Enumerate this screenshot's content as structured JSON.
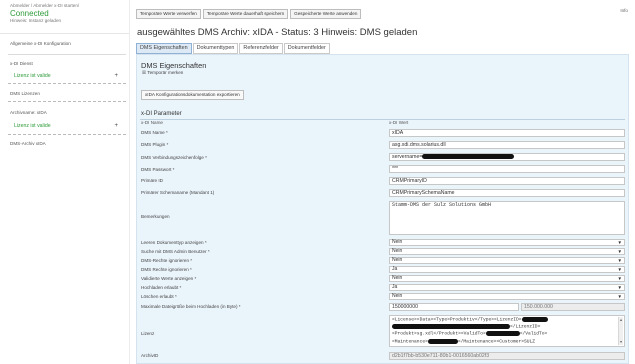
{
  "sidebar": {
    "connection_hint_1": "Abmelder / Abmelder x-DI starten/",
    "status": "Connected",
    "connection_hint_2": "Hinweis: Instanz geladen",
    "allgemein": "Allgemeine x-DI Konfiguration",
    "item1_caption": "x-DI Dienst",
    "item1_value": "Lizenz ist valide",
    "item2_caption": "DMS Lizenzen",
    "item3_caption": "Archivname: xIDA",
    "item3_value": "Lizenz ist valide",
    "item4_caption": "DMS-Archiv xIDA",
    "plus": "+"
  },
  "toolbar": {
    "btn1": "Temporäre Werte verwerfen",
    "btn2": "Temporäre Werte dauerhaft speichern",
    "btn3": "Gespeicherte Werte anwenden",
    "corner": "Info"
  },
  "heading": "ausgewähltes DMS Archiv: xIDA  - Status: 3  Hinweis: DMS geladen",
  "tabs": [
    "DMS Eigenschaften",
    "Dokumenttypen",
    "Referenzfelder",
    "Dokumentfelder"
  ],
  "panel": {
    "title": "DMS Eigenschaften",
    "temp_check": "☒ Temporär merken",
    "export_button": "xIDA Konfigurationsdokumentation exportieren",
    "section": "x-DI Parameter",
    "col_name": "x-DI Name",
    "col_value": "x-DI Wert"
  },
  "fields": [
    {
      "label": "DMS Name *",
      "value": "xIDA"
    },
    {
      "label": "DMS Plugin *",
      "value": "asg.xdi.dms.solarius.dll"
    },
    {
      "label": "DMS Verbindungszeichenfolge *",
      "value": "servername="
    },
    {
      "label": "DMS Passwort *",
      "value": "***"
    },
    {
      "label": "Primäre ID",
      "value": "CRMPrimaryID"
    },
    {
      "label": "Primärer Schemaname (Mandant 1)",
      "value": "CRMPrimarySchemaName"
    }
  ],
  "remarks": {
    "label": "Bemerkungen",
    "value": "Stamm-DMS der Sulz Solutions GmbH"
  },
  "selects": [
    {
      "label": "Leeren Dokumenttyp anzeigen *",
      "value": "Nein"
    },
    {
      "label": "Suche mit DMS Admin Benutzer *",
      "value": "Nein"
    },
    {
      "label": "DMS-Rechte ignorieren *",
      "value": "Nein"
    },
    {
      "label": "DMS Rechte ignorieren *",
      "value": "Ja"
    },
    {
      "label": "Validierte Werte anzeigen *",
      "value": "Nein"
    },
    {
      "label": "Hochladen erlaubt *",
      "value": "Ja"
    },
    {
      "label": "Löschen erlaubt *",
      "value": "Nein"
    }
  ],
  "maxsize": {
    "label": "Maximale Dateigröße beim Hochladen (in Byte) *",
    "value": "150000000",
    "hint": "150.000.000"
  },
  "license": {
    "label": "Lizenz",
    "line1": "<License><Data><Type>Produktiv</Type><LizenzID>",
    "line2": "</LizenzID>",
    "line3": "<Produkt>sg.xdl</Produkt><ValidTo>",
    "line3b": "</ValidTo>",
    "line4": "<Maintenance>",
    "line4b": "</Maintenance><Customer>SULZ"
  },
  "archiv": {
    "label": "ArchivID",
    "value": "d2b1f7bb-b530e711-80b1-0016560ab02f3"
  }
}
